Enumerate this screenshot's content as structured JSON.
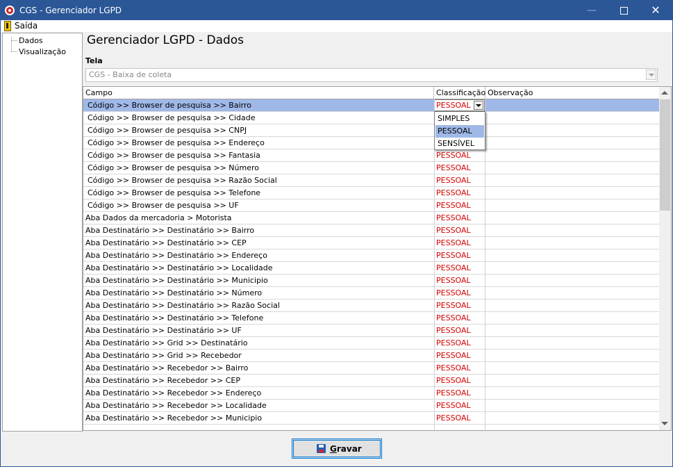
{
  "window": {
    "title": "CGS - Gerenciador LGPD",
    "minimize_glyph": "—",
    "close_glyph": "✕"
  },
  "menu": {
    "saida_label": "Saída",
    "saida_icon": "exit-door-icon"
  },
  "tree": {
    "items": [
      "Dados",
      "Visualização"
    ]
  },
  "main": {
    "title": "Gerenciador LGPD - Dados",
    "tela_label": "Tela",
    "tela_value": "CGS - Baixa de coleta"
  },
  "grid": {
    "columns": [
      "Campo",
      "Classificação",
      "Observação"
    ],
    "rows": [
      {
        "campo": "Código >> Browser de pesquisa >> Bairro",
        "classificacao": "PESSOAL",
        "observacao": ""
      },
      {
        "campo": "Código >> Browser de pesquisa >> Cidade",
        "classificacao": "",
        "observacao": ""
      },
      {
        "campo": "Código >> Browser de pesquisa >> CNPJ",
        "classificacao": "",
        "observacao": ""
      },
      {
        "campo": "Código >> Browser de pesquisa >> Endereço",
        "classificacao": "",
        "observacao": ""
      },
      {
        "campo": "Código >> Browser de pesquisa >> Fantasia",
        "classificacao": "PESSOAL",
        "observacao": ""
      },
      {
        "campo": "Código >> Browser de pesquisa >> Número",
        "classificacao": "PESSOAL",
        "observacao": ""
      },
      {
        "campo": "Código >> Browser de pesquisa >> Razão Social",
        "classificacao": "PESSOAL",
        "observacao": ""
      },
      {
        "campo": "Código >> Browser de pesquisa >> Telefone",
        "classificacao": "PESSOAL",
        "observacao": ""
      },
      {
        "campo": "Código >> Browser de pesquisa >> UF",
        "classificacao": "PESSOAL",
        "observacao": ""
      },
      {
        "campo": "Aba Dados da mercadoria > Motorista",
        "classificacao": "PESSOAL",
        "observacao": ""
      },
      {
        "campo": "Aba Destinatário >> Destinatário >> Bairro",
        "classificacao": "PESSOAL",
        "observacao": ""
      },
      {
        "campo": "Aba Destinatário >> Destinatário >> CEP",
        "classificacao": "PESSOAL",
        "observacao": ""
      },
      {
        "campo": "Aba Destinatário >> Destinatário >> Endereço",
        "classificacao": "PESSOAL",
        "observacao": ""
      },
      {
        "campo": "Aba Destinatário >> Destinatário >> Localidade",
        "classificacao": "PESSOAL",
        "observacao": ""
      },
      {
        "campo": "Aba Destinatário >> Destinatário >> Municipio",
        "classificacao": "PESSOAL",
        "observacao": ""
      },
      {
        "campo": "Aba Destinatário >> Destinatário >> Número",
        "classificacao": "PESSOAL",
        "observacao": ""
      },
      {
        "campo": "Aba Destinatário >> Destinatário >> Razão Social",
        "classificacao": "PESSOAL",
        "observacao": ""
      },
      {
        "campo": "Aba Destinatário >> Destinatário >> Telefone",
        "classificacao": "PESSOAL",
        "observacao": ""
      },
      {
        "campo": "Aba Destinatário >> Destinatário >> UF",
        "classificacao": "PESSOAL",
        "observacao": ""
      },
      {
        "campo": "Aba Destinatário >> Grid >> Destinatário",
        "classificacao": "PESSOAL",
        "observacao": ""
      },
      {
        "campo": "Aba Destinatário >> Grid >> Recebedor",
        "classificacao": "PESSOAL",
        "observacao": ""
      },
      {
        "campo": "Aba Destinatário >> Recebedor >> Bairro",
        "classificacao": "PESSOAL",
        "observacao": ""
      },
      {
        "campo": "Aba Destinatário >> Recebedor >> CEP",
        "classificacao": "PESSOAL",
        "observacao": ""
      },
      {
        "campo": "Aba Destinatário >> Recebedor >> Endereço",
        "classificacao": "PESSOAL",
        "observacao": ""
      },
      {
        "campo": "Aba Destinatário >> Recebedor >> Localidade",
        "classificacao": "PESSOAL",
        "observacao": ""
      },
      {
        "campo": "Aba Destinatário >> Recebedor >> Municipio",
        "classificacao": "PESSOAL",
        "observacao": ""
      }
    ],
    "editor_value": "PESSOAL",
    "dropdown_options": [
      "SIMPLES",
      "PESSOAL",
      "SENSÍVEL"
    ],
    "dropdown_selected": "PESSOAL"
  },
  "actions": {
    "save_label": "Gravar",
    "save_icon": "save-disk-icon"
  },
  "colors": {
    "titlebar": "#2b5797",
    "selection": "#9fb8e8",
    "classification_text": "#d40000",
    "focus_border": "#0078d7"
  }
}
